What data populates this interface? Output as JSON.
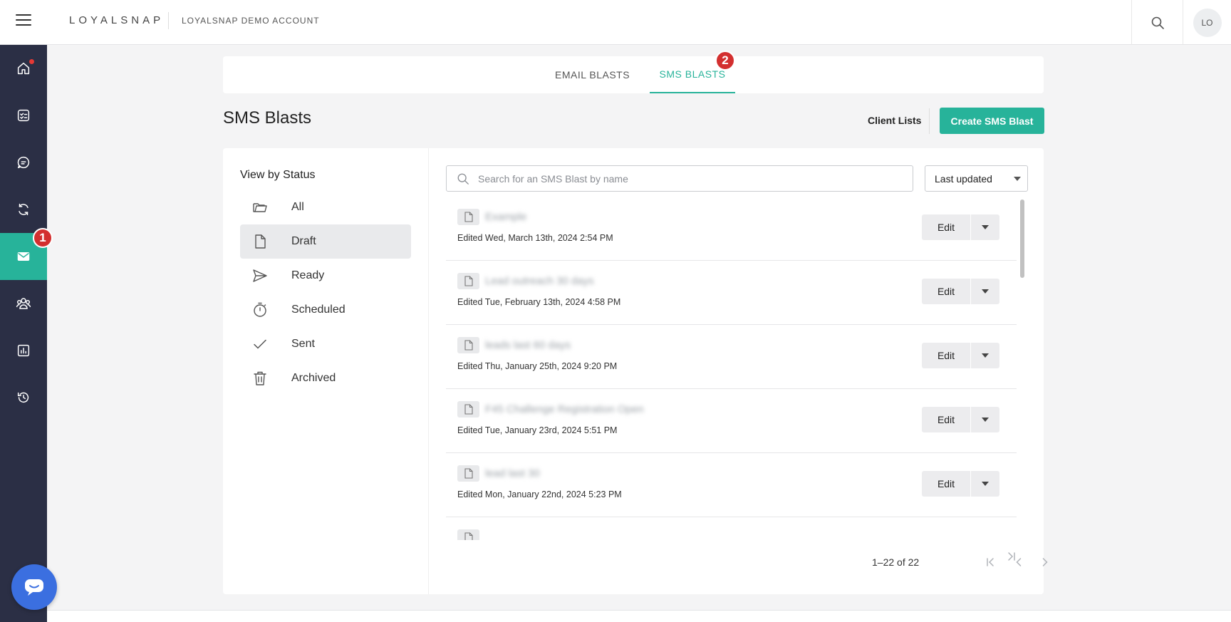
{
  "header": {
    "logo": "LOYALSNAP",
    "account": "LOYALSNAP DEMO ACCOUNT",
    "avatar_initials": "LO"
  },
  "nav": {
    "items": [
      "home-icon",
      "tasks-icon",
      "chat-icon",
      "refresh-icon",
      "mail-icon",
      "community-icon",
      "report-icon",
      "history-icon"
    ],
    "active": "mail-icon"
  },
  "badges": {
    "nav_badge": "1",
    "tab_badge": "2"
  },
  "tabs": [
    {
      "label": "EMAIL BLASTS"
    },
    {
      "label": "SMS BLASTS"
    }
  ],
  "page": {
    "title": "SMS Blasts",
    "client_lists": "Client Lists",
    "create_button": "Create SMS Blast"
  },
  "status": {
    "title": "View by Status",
    "items": [
      {
        "label": "All",
        "icon": "folder-icon"
      },
      {
        "label": "Draft",
        "icon": "document-icon"
      },
      {
        "label": "Ready",
        "icon": "send-icon"
      },
      {
        "label": "Scheduled",
        "icon": "timer-icon"
      },
      {
        "label": "Sent",
        "icon": "check-icon"
      },
      {
        "label": "Archived",
        "icon": "trash-icon"
      }
    ]
  },
  "search": {
    "placeholder": "Search for an SMS Blast by name",
    "value": ""
  },
  "sort": {
    "selected": "Last updated"
  },
  "blasts": [
    {
      "name": "Example",
      "edited": "Edited Wed, March 13th, 2024 2:54 PM"
    },
    {
      "name": "Lead outreach 30 days",
      "edited": "Edited Tue, February 13th, 2024 4:58 PM"
    },
    {
      "name": "leads last 60 days",
      "edited": "Edited Thu, January 25th, 2024 9:20 PM"
    },
    {
      "name": "F45 Challenge Registration Open",
      "edited": "Edited Tue, January 23rd, 2024 5:51 PM"
    },
    {
      "name": "lead last 30",
      "edited": "Edited Mon, January 22nd, 2024 5:23 PM"
    }
  ],
  "row_action": {
    "edit_label": "Edit"
  },
  "pagination": {
    "text": "1–22 of 22"
  },
  "colors": {
    "accent": "#27b39a",
    "nav_bg": "#2b2f45",
    "badge": "#d32f2f",
    "chat": "#3b6fe0"
  }
}
